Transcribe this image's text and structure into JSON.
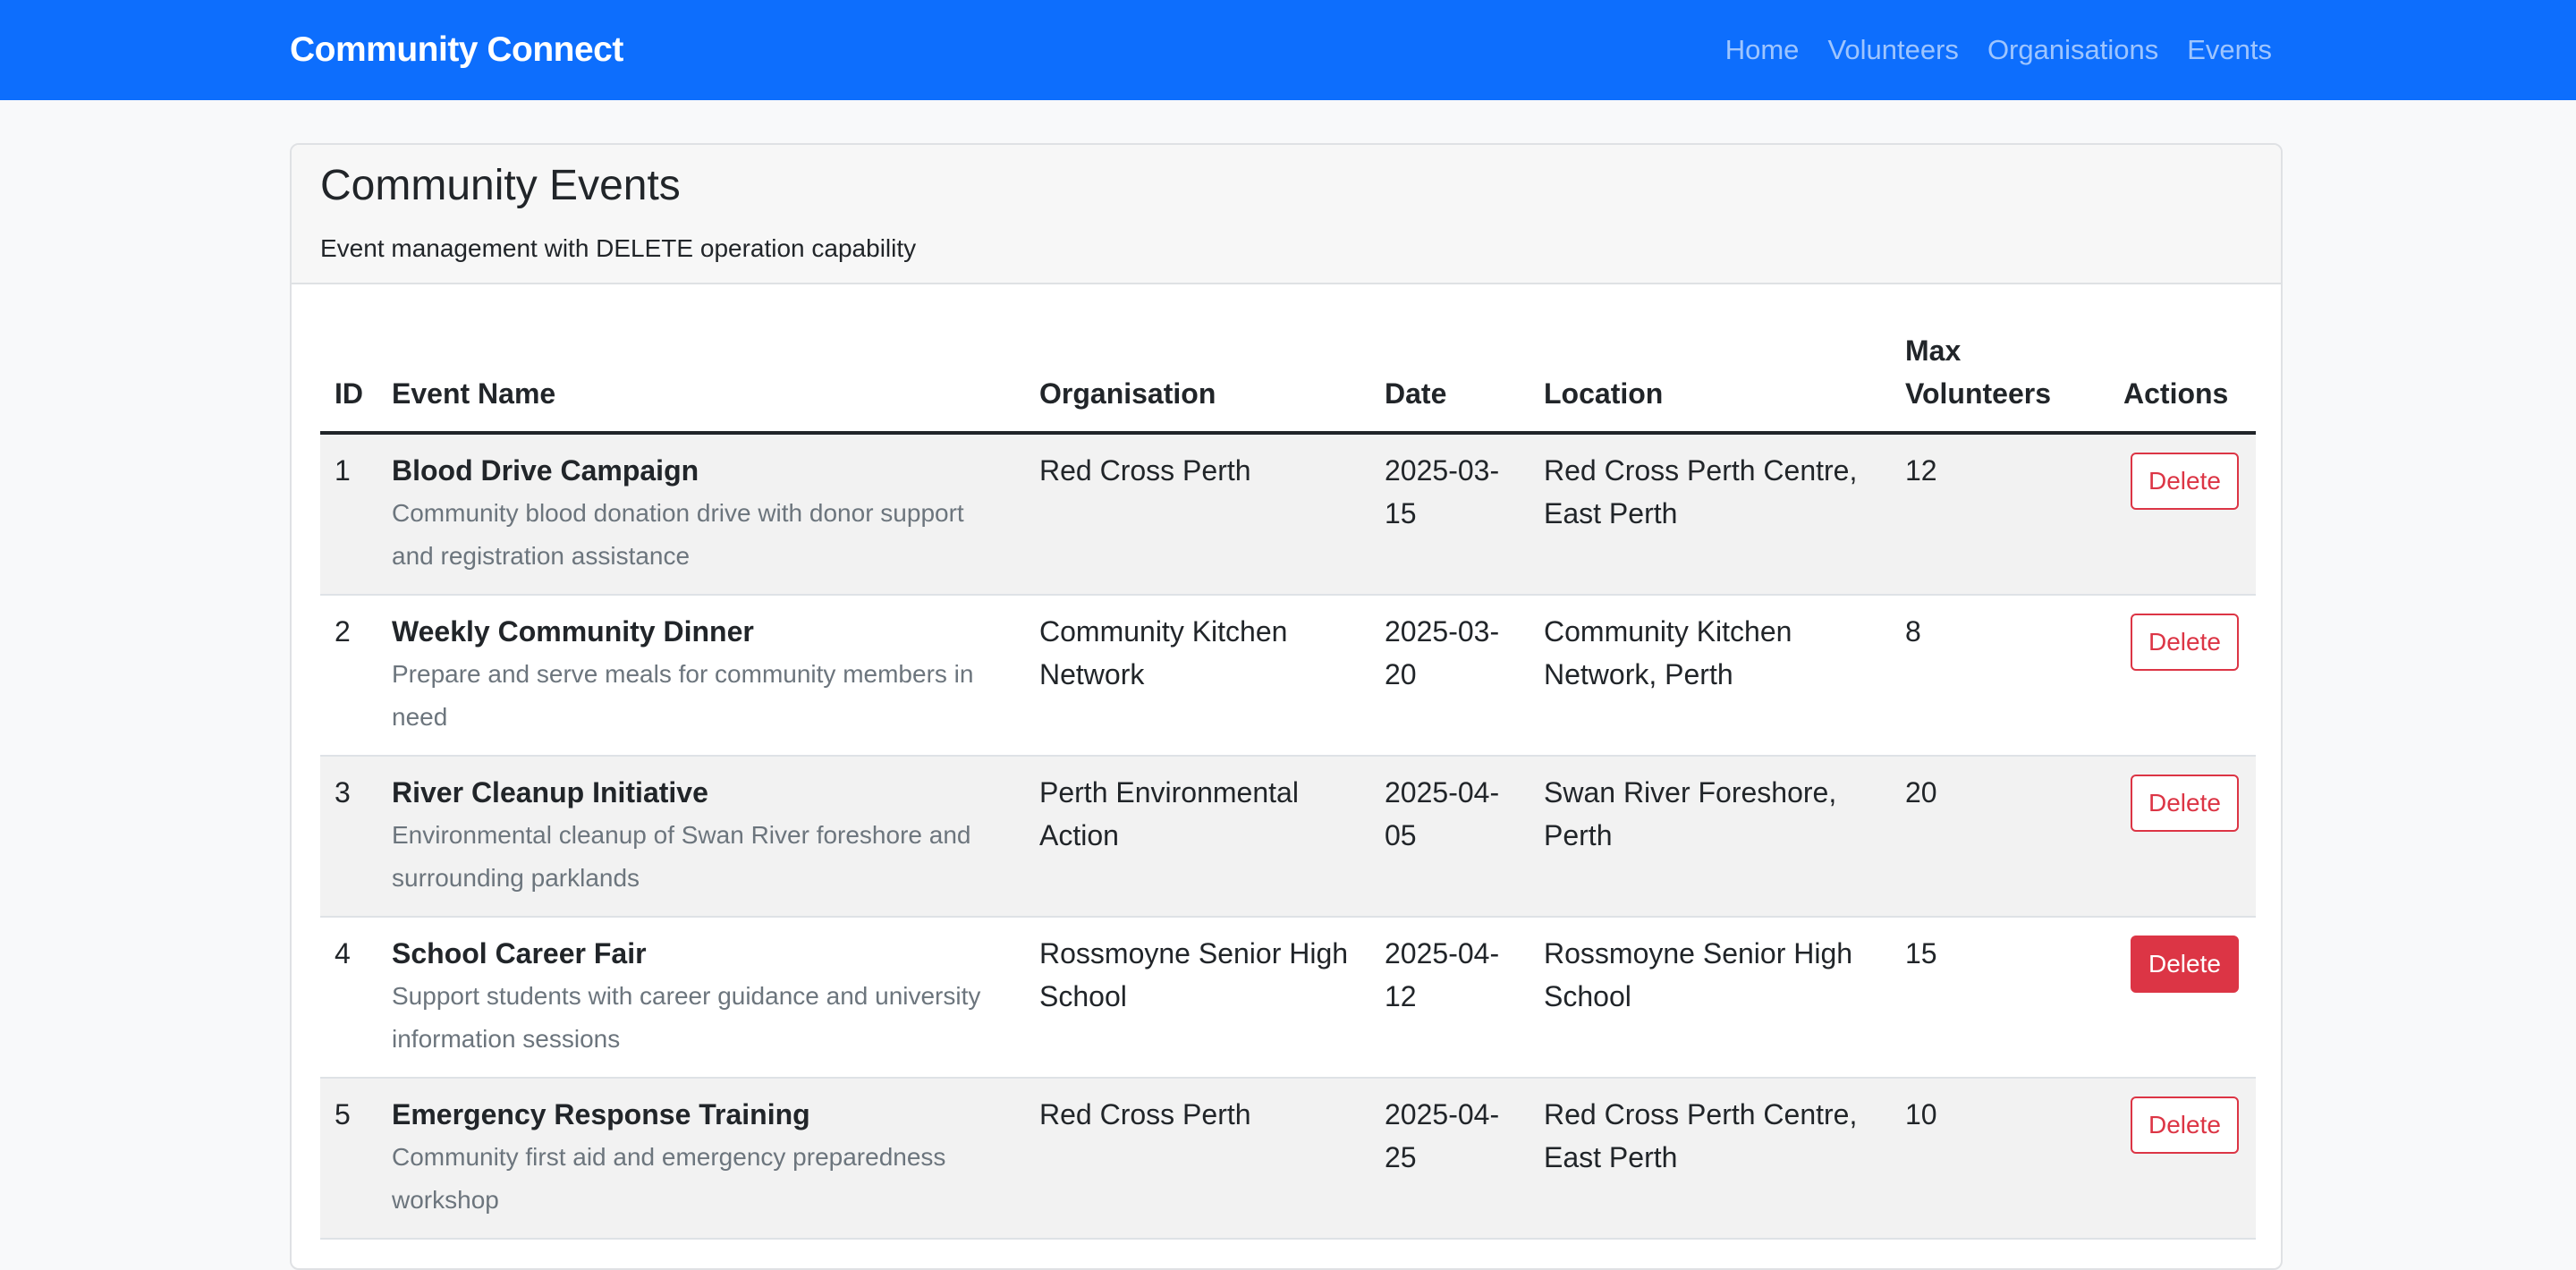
{
  "navbar": {
    "brand": "Community Connect",
    "links": [
      "Home",
      "Volunteers",
      "Organisations",
      "Events"
    ]
  },
  "card": {
    "title": "Community Events",
    "subtitle": "Event management with DELETE operation capability"
  },
  "table": {
    "headers": {
      "id": "ID",
      "name": "Event Name",
      "org": "Organisation",
      "date": "Date",
      "location": "Location",
      "max": "Max Volunteers",
      "actions": "Actions"
    },
    "rows": [
      {
        "id": "1",
        "name": "Blood Drive Campaign",
        "desc": "Community blood donation drive with donor support and registration assistance",
        "org": "Red Cross Perth",
        "date": "2025-03-15",
        "location": "Red Cross Perth Centre, East Perth",
        "max": "12",
        "action": "Delete"
      },
      {
        "id": "2",
        "name": "Weekly Community Dinner",
        "desc": "Prepare and serve meals for community members in need",
        "org": "Community Kitchen Network",
        "date": "2025-03-20",
        "location": "Community Kitchen Network, Perth",
        "max": "8",
        "action": "Delete"
      },
      {
        "id": "3",
        "name": "River Cleanup Initiative",
        "desc": "Environmental cleanup of Swan River foreshore and surrounding parklands",
        "org": "Perth Environmental Action",
        "date": "2025-04-05",
        "location": "Swan River Foreshore, Perth",
        "max": "20",
        "action": "Delete"
      },
      {
        "id": "4",
        "name": "School Career Fair",
        "desc": "Support students with career guidance and university information sessions",
        "org": "Rossmoyne Senior High School",
        "date": "2025-04-12",
        "location": "Rossmoyne Senior High School",
        "max": "15",
        "action": "Delete"
      },
      {
        "id": "5",
        "name": "Emergency Response Training",
        "desc": "Community first aid and emergency preparedness workshop",
        "org": "Red Cross Perth",
        "date": "2025-04-25",
        "location": "Red Cross Perth Centre, East Perth",
        "max": "10",
        "action": "Delete"
      }
    ]
  }
}
